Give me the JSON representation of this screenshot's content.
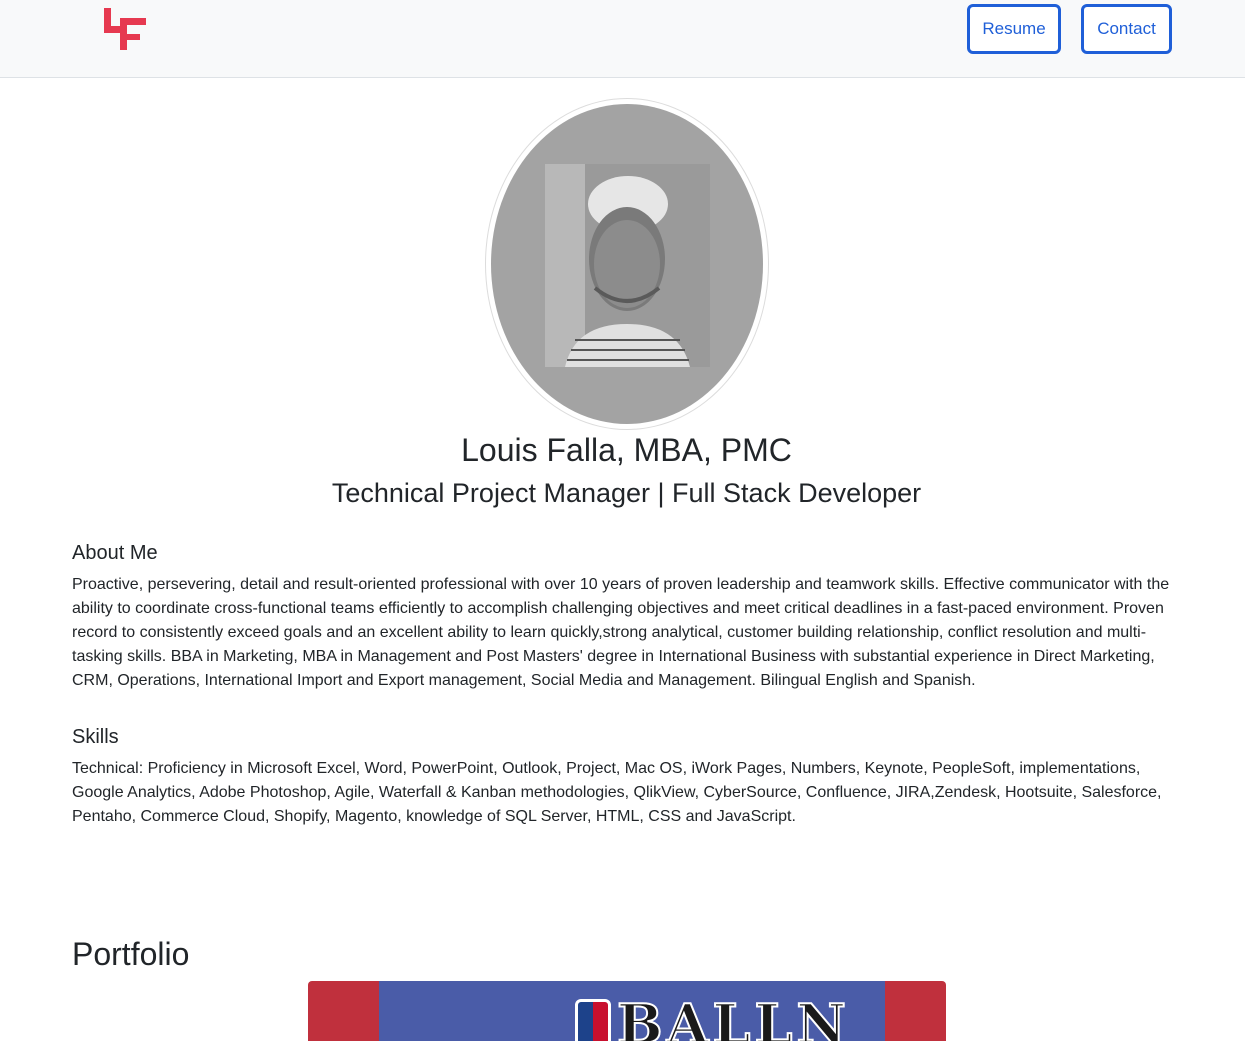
{
  "header": {
    "logo_icon": "lf-monogram-logo",
    "brand_color": "#e63950",
    "nav": {
      "resume_label": "Resume",
      "contact_label": "Contact"
    },
    "button_color": "#1f5fd8"
  },
  "profile": {
    "name": "Louis Falla, MBA, PMC",
    "title": "Technical Project Manager | Full Stack Developer",
    "avatar_icon": "profile-photo"
  },
  "about": {
    "heading": "About Me",
    "text": "Proactive, persevering, detail and result-oriented professional with over 10 years of proven leadership and teamwork skills. Effective communicator with the ability to coordinate cross-functional teams efficiently to accomplish challenging objectives and meet critical deadlines in a fast-paced environment. Proven record to consistently exceed goals and an excellent ability to learn quickly,strong analytical, customer building relationship, conflict resolution and multi-tasking skills. BBA in Marketing, MBA in Management and Post Masters' degree in International Business with substantial experience in Direct Marketing, CRM, Operations, International Import and Export management, Social Media and Management. Bilingual English and Spanish."
  },
  "skills": {
    "heading": "Skills",
    "text": "Technical: Proficiency in Microsoft Excel, Word, PowerPoint, Outlook, Project, Mac OS, iWork Pages, Numbers, Keynote, PeopleSoft, implementations, Google Analytics, Adobe Photoshop, Agile, Waterfall & Kanban methodologies, QlikView, CyberSource, Confluence, JIRA,Zendesk, Hootsuite, Salesforce, Pentaho, Commerce Cloud, Shopify, Magento, knowledge of SQL Server, HTML, CSS and JavaScript."
  },
  "portfolio": {
    "heading": "Portfolio",
    "card_text": "BALLN"
  }
}
